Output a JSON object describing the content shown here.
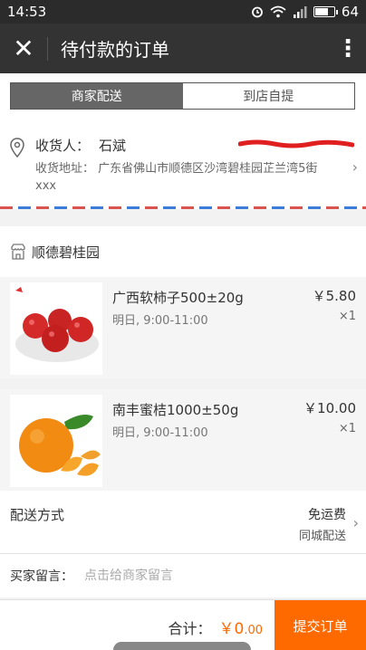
{
  "status_bar": {
    "time": "14:53",
    "battery": "64",
    "battery_level": 0.64
  },
  "title_bar": {
    "close_glyph": "✕",
    "title": "待付款的订单",
    "more_glyph": "⋮"
  },
  "delivery_tabs": [
    {
      "label": "商家配送",
      "active": true
    },
    {
      "label": "到店自提",
      "active": false
    }
  ],
  "address": {
    "receiver_label": "收货人：",
    "receiver_name": "石斌",
    "address_label": "收货地址：",
    "address_text": "广东省佛山市顺德区沙湾碧桂园芷兰湾5街xxx",
    "icon": "location-pin-icon"
  },
  "shop": {
    "name": "顺德碧桂园",
    "icon": "store-icon"
  },
  "items": [
    {
      "name": "广西软柿子500±20g",
      "delivery_time": "明日, 9:00-11:00",
      "price": "￥5.80",
      "qty": "×1",
      "image": "persimmon-image"
    },
    {
      "name": "南丰蜜桔1000±50g",
      "delivery_time": "明日, 9:00-11:00",
      "price": "￥10.00",
      "qty": "×1",
      "image": "tangerine-image"
    }
  ],
  "delivery": {
    "label": "配送方式",
    "fee": "免运费",
    "method": "同城配送"
  },
  "message": {
    "label": "买家留言：",
    "placeholder": "点击给商家留言"
  },
  "footer": {
    "total_label": "合计：",
    "currency": "￥",
    "amount_int": "0",
    "amount_dec": ".00",
    "submit_label": "提交订单"
  },
  "colors": {
    "accent": "#ff6a00",
    "titlebar": "#333333",
    "segment_active": "#666666"
  }
}
